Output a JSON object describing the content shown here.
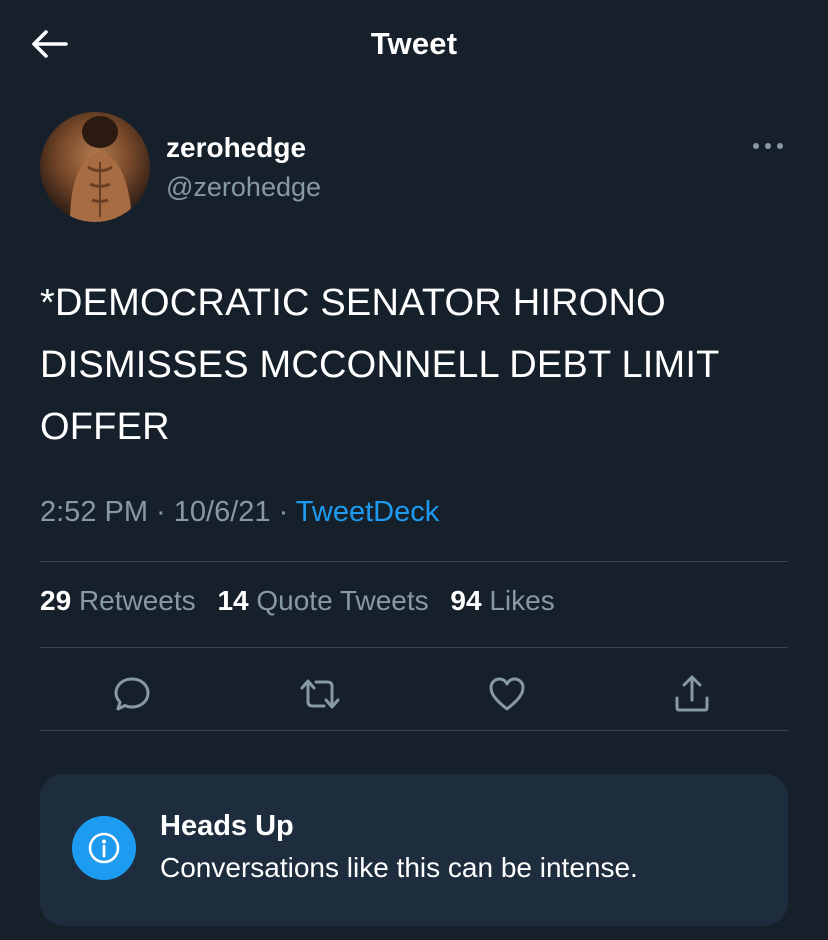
{
  "header": {
    "title": "Tweet",
    "back_icon": "arrow-left-icon"
  },
  "tweet": {
    "display_name": "zerohedge",
    "handle": "@zerohedge",
    "text": "*DEMOCRATIC SENATOR HIRONO DISMISSES MCCONNELL DEBT LIMIT OFFER",
    "time": "2:52 PM",
    "separator": " · ",
    "date": "10/6/21",
    "source": "TweetDeck"
  },
  "stats": {
    "retweets_count": "29",
    "retweets_label": "Retweets",
    "quotes_count": "14",
    "quotes_label": "Quote Tweets",
    "likes_count": "94",
    "likes_label": "Likes"
  },
  "actions": [
    "reply-icon",
    "retweet-icon",
    "like-icon",
    "share-icon"
  ],
  "notice": {
    "title": "Heads Up",
    "body": "Conversations like this can be intense.",
    "icon": "info-icon"
  },
  "colors": {
    "background": "#15202b",
    "secondary_text": "#8899a6",
    "accent": "#1d9bf0",
    "notice_bg": "#1e2d3d",
    "divider": "#38444d"
  }
}
